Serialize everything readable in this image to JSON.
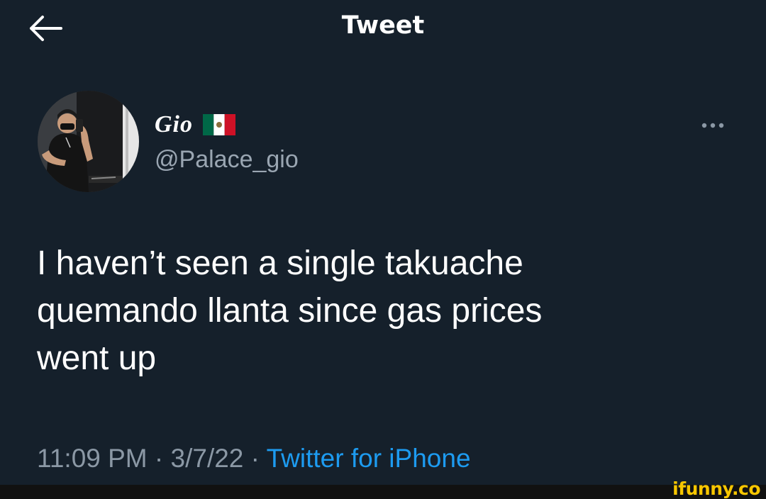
{
  "header": {
    "title": "Tweet",
    "back_icon": "arrow-left-icon"
  },
  "author": {
    "display_name": "Gio",
    "flag_icon": "mexico-flag-icon",
    "handle": "@Palace_gio",
    "avatar_icon": "profile-photo"
  },
  "more_icon": "more-horizontal-icon",
  "tweet": {
    "lines": [
      "I haven’t seen a single takuache",
      "quemando llanta since gas prices",
      "went up"
    ]
  },
  "meta": {
    "time": "11:09 PM",
    "sep1": " · ",
    "date": "3/7/22",
    "sep2": " · ",
    "source": "Twitter for iPhone"
  },
  "watermark": {
    "text": "ifunny.co"
  },
  "colors": {
    "background": "#15202b",
    "secondary_text": "#8b98a5",
    "link": "#1d9bf0",
    "watermark": "#f7c600"
  }
}
